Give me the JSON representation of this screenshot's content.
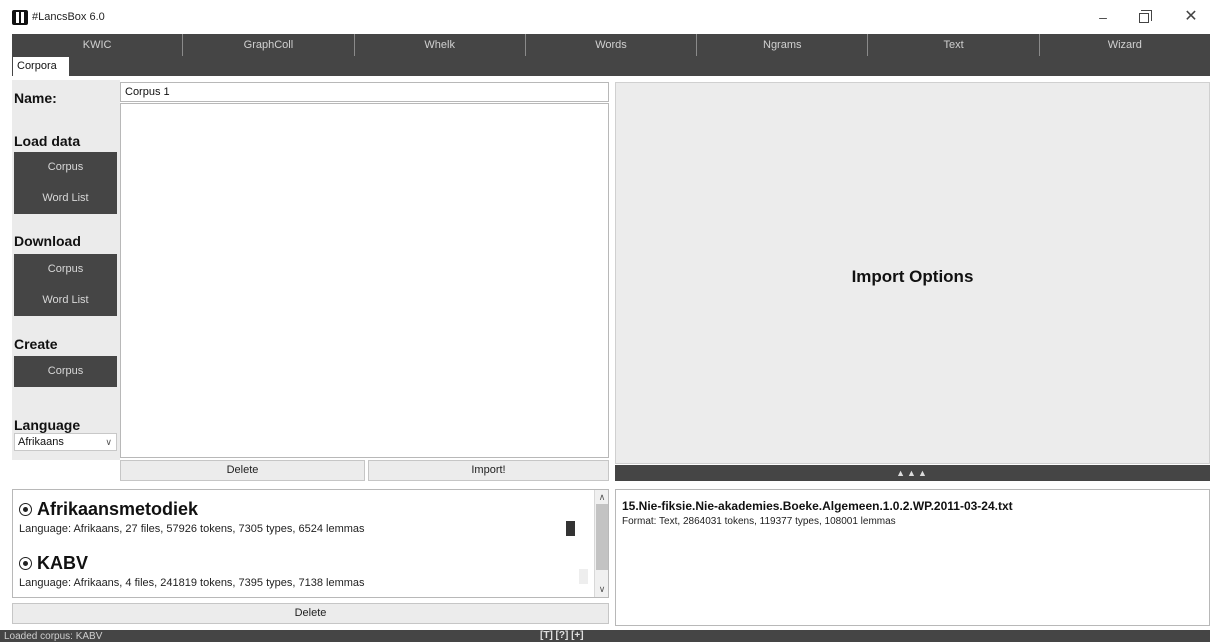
{
  "window": {
    "title": "#LancsBox 6.0",
    "minimize": "–",
    "close": "✕"
  },
  "top_tabs": [
    "KWIC",
    "GraphColl",
    "Whelk",
    "Words",
    "Ngrams",
    "Text",
    "Wizard"
  ],
  "sub_tab": "Corpora",
  "left_panel": {
    "name_label": "Name:",
    "load_data_label": "Load data",
    "load_corpus_button": "Corpus",
    "load_wordlist_button": "Word List",
    "download_label": "Download",
    "download_corpus_button": "Corpus",
    "download_wordlist_button": "Word List",
    "create_label": "Create",
    "create_corpus_button": "Corpus",
    "language_label": "Language",
    "language_selected": "Afrikaans"
  },
  "corpus_name_value": "Corpus 1",
  "buttons": {
    "delete_main": "Delete",
    "import": "Import!",
    "delete_list": "Delete"
  },
  "import_panel": {
    "title": "Import Options",
    "collapse_arrows": "▲▲▲"
  },
  "corpus_list": [
    {
      "name": "Afrikaansmetodiek",
      "desc": "Language: Afrikaans, 27 files, 57926 tokens, 7305 types, 6524 lemmas"
    },
    {
      "name": "KABV",
      "desc": "Language: Afrikaans, 4 files, 241819 tokens, 7395 types, 7138 lemmas"
    }
  ],
  "detail": {
    "file": "15.Nie-fiksie.Nie-akademies.Boeke.Algemeen.1.0.2.WP.2011-03-24.txt",
    "format": "Format: Text, 2864031 tokens, 119377 types, 108001 lemmas"
  },
  "status": {
    "text": "Loaded corpus: KABV",
    "icons": "[T] [?] [+]"
  },
  "colors": {
    "dark": "#454545",
    "panel_light": "#ececec"
  }
}
